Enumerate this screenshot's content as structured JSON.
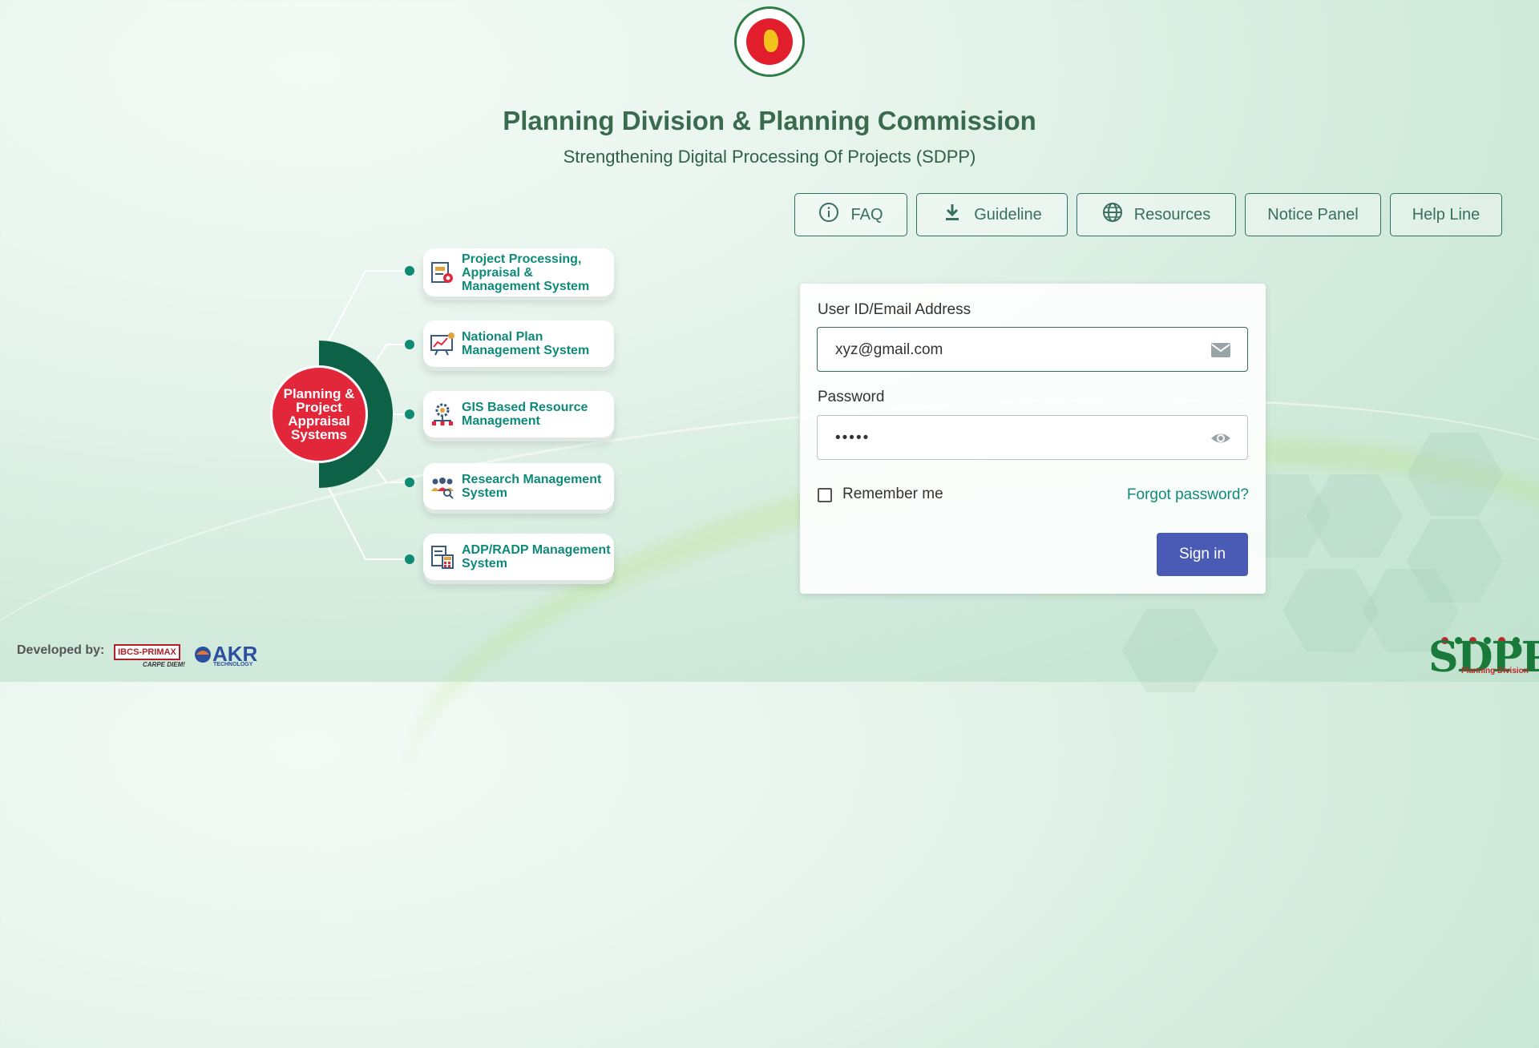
{
  "header": {
    "title": "Planning Division & Planning Commission",
    "subtitle": "Strengthening Digital Processing Of Projects (SDPP)"
  },
  "nav": [
    {
      "label": "FAQ",
      "icon": "info-icon"
    },
    {
      "label": "Guideline",
      "icon": "download-icon"
    },
    {
      "label": "Resources",
      "icon": "globe-icon"
    },
    {
      "label": "Notice Panel"
    },
    {
      "label": "Help Line"
    }
  ],
  "diagram": {
    "hub_label": "Planning & Project Appraisal Systems",
    "systems": [
      {
        "label": "Project Processing, Appraisal & Management System",
        "icon": "document-gear-icon"
      },
      {
        "label": "National Plan Management System",
        "icon": "chart-board-icon"
      },
      {
        "label": "GIS Based Resource Management",
        "icon": "gear-network-icon"
      },
      {
        "label": "Research Management System",
        "icon": "people-search-icon"
      },
      {
        "label": "ADP/RADP Management System",
        "icon": "calculator-document-icon"
      }
    ]
  },
  "login": {
    "user_label": "User ID/Email Address",
    "user_value": "xyz@gmail.com",
    "user_icon": "mail-icon",
    "password_label": "Password",
    "password_value": "•••••",
    "password_icon": "eye-icon",
    "remember_label": "Remember me",
    "forgot_label": "Forgot password?",
    "signin_label": "Sign in"
  },
  "footer": {
    "developed_by": "Developed by:",
    "logo1_text": "IBCS-PRIMAX",
    "logo1_tagline": "CARPE DIEM!",
    "logo2_text": "AKR",
    "logo2_sub": "TECHNOLOGY",
    "brand": "SDPP",
    "brand_sub": "Planning Division"
  },
  "colors": {
    "primary_green": "#0d6147",
    "accent_red": "#e3273b",
    "teal_text": "#0e8a78",
    "signin_blue": "#4a5bb5"
  }
}
